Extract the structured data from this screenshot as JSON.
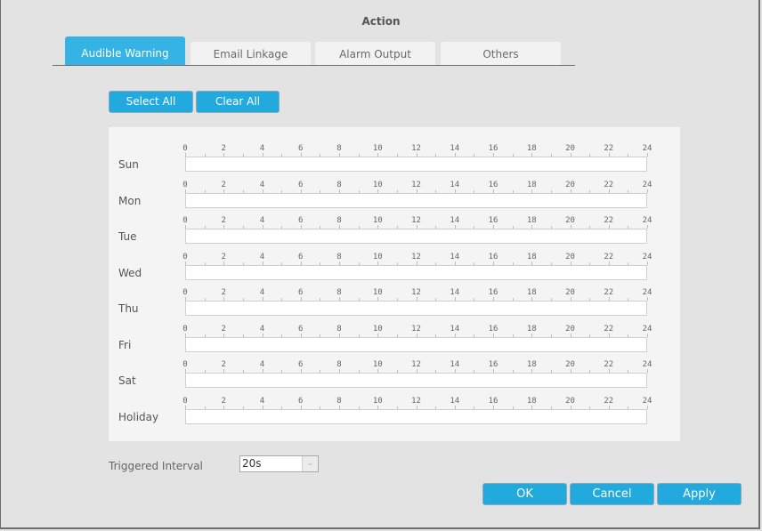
{
  "dialog": {
    "title": "Action"
  },
  "tabs": [
    {
      "label": "Audible Warning",
      "active": true
    },
    {
      "label": "Email Linkage",
      "active": false
    },
    {
      "label": "Alarm Output",
      "active": false
    },
    {
      "label": "Others",
      "active": false
    }
  ],
  "toolbar": {
    "select_all_label": "Select All",
    "clear_all_label": "Clear All"
  },
  "schedule": {
    "tick_labels": [
      "0",
      "2",
      "4",
      "6",
      "8",
      "10",
      "12",
      "14",
      "16",
      "18",
      "20",
      "22",
      "24"
    ],
    "days": [
      {
        "label": "Sun"
      },
      {
        "label": "Mon"
      },
      {
        "label": "Tue"
      },
      {
        "label": "Wed"
      },
      {
        "label": "Thu"
      },
      {
        "label": "Fri"
      },
      {
        "label": "Sat"
      },
      {
        "label": "Holiday"
      }
    ]
  },
  "triggered_interval": {
    "label": "Triggered Interval",
    "value": "20s"
  },
  "footer": {
    "ok_label": "OK",
    "cancel_label": "Cancel",
    "apply_label": "Apply"
  },
  "colors": {
    "accent": "#22aadf",
    "active_tab": "#35b3e4"
  }
}
